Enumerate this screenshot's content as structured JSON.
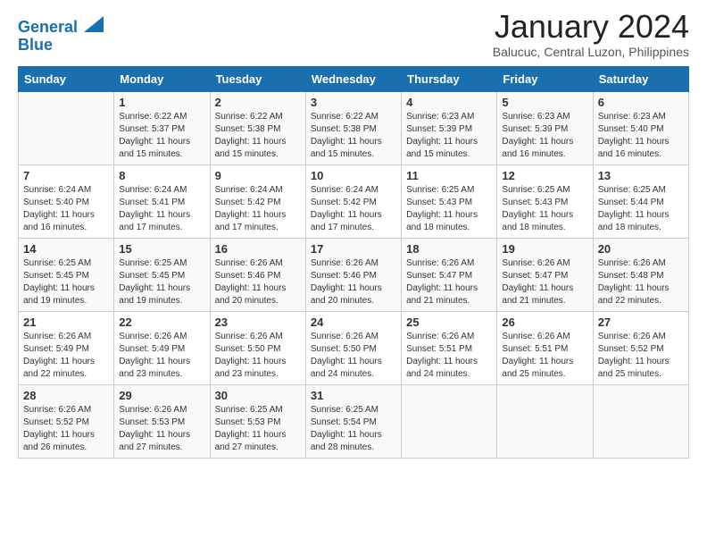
{
  "header": {
    "logo_line1": "General",
    "logo_line2": "Blue",
    "month_title": "January 2024",
    "subtitle": "Balucuc, Central Luzon, Philippines"
  },
  "weekdays": [
    "Sunday",
    "Monday",
    "Tuesday",
    "Wednesday",
    "Thursday",
    "Friday",
    "Saturday"
  ],
  "weeks": [
    [
      {
        "day": "",
        "sunrise": "",
        "sunset": "",
        "daylight": ""
      },
      {
        "day": "1",
        "sunrise": "Sunrise: 6:22 AM",
        "sunset": "Sunset: 5:37 PM",
        "daylight": "Daylight: 11 hours and 15 minutes."
      },
      {
        "day": "2",
        "sunrise": "Sunrise: 6:22 AM",
        "sunset": "Sunset: 5:38 PM",
        "daylight": "Daylight: 11 hours and 15 minutes."
      },
      {
        "day": "3",
        "sunrise": "Sunrise: 6:22 AM",
        "sunset": "Sunset: 5:38 PM",
        "daylight": "Daylight: 11 hours and 15 minutes."
      },
      {
        "day": "4",
        "sunrise": "Sunrise: 6:23 AM",
        "sunset": "Sunset: 5:39 PM",
        "daylight": "Daylight: 11 hours and 15 minutes."
      },
      {
        "day": "5",
        "sunrise": "Sunrise: 6:23 AM",
        "sunset": "Sunset: 5:39 PM",
        "daylight": "Daylight: 11 hours and 16 minutes."
      },
      {
        "day": "6",
        "sunrise": "Sunrise: 6:23 AM",
        "sunset": "Sunset: 5:40 PM",
        "daylight": "Daylight: 11 hours and 16 minutes."
      }
    ],
    [
      {
        "day": "7",
        "sunrise": "Sunrise: 6:24 AM",
        "sunset": "Sunset: 5:40 PM",
        "daylight": "Daylight: 11 hours and 16 minutes."
      },
      {
        "day": "8",
        "sunrise": "Sunrise: 6:24 AM",
        "sunset": "Sunset: 5:41 PM",
        "daylight": "Daylight: 11 hours and 17 minutes."
      },
      {
        "day": "9",
        "sunrise": "Sunrise: 6:24 AM",
        "sunset": "Sunset: 5:42 PM",
        "daylight": "Daylight: 11 hours and 17 minutes."
      },
      {
        "day": "10",
        "sunrise": "Sunrise: 6:24 AM",
        "sunset": "Sunset: 5:42 PM",
        "daylight": "Daylight: 11 hours and 17 minutes."
      },
      {
        "day": "11",
        "sunrise": "Sunrise: 6:25 AM",
        "sunset": "Sunset: 5:43 PM",
        "daylight": "Daylight: 11 hours and 18 minutes."
      },
      {
        "day": "12",
        "sunrise": "Sunrise: 6:25 AM",
        "sunset": "Sunset: 5:43 PM",
        "daylight": "Daylight: 11 hours and 18 minutes."
      },
      {
        "day": "13",
        "sunrise": "Sunrise: 6:25 AM",
        "sunset": "Sunset: 5:44 PM",
        "daylight": "Daylight: 11 hours and 18 minutes."
      }
    ],
    [
      {
        "day": "14",
        "sunrise": "Sunrise: 6:25 AM",
        "sunset": "Sunset: 5:45 PM",
        "daylight": "Daylight: 11 hours and 19 minutes."
      },
      {
        "day": "15",
        "sunrise": "Sunrise: 6:25 AM",
        "sunset": "Sunset: 5:45 PM",
        "daylight": "Daylight: 11 hours and 19 minutes."
      },
      {
        "day": "16",
        "sunrise": "Sunrise: 6:26 AM",
        "sunset": "Sunset: 5:46 PM",
        "daylight": "Daylight: 11 hours and 20 minutes."
      },
      {
        "day": "17",
        "sunrise": "Sunrise: 6:26 AM",
        "sunset": "Sunset: 5:46 PM",
        "daylight": "Daylight: 11 hours and 20 minutes."
      },
      {
        "day": "18",
        "sunrise": "Sunrise: 6:26 AM",
        "sunset": "Sunset: 5:47 PM",
        "daylight": "Daylight: 11 hours and 21 minutes."
      },
      {
        "day": "19",
        "sunrise": "Sunrise: 6:26 AM",
        "sunset": "Sunset: 5:47 PM",
        "daylight": "Daylight: 11 hours and 21 minutes."
      },
      {
        "day": "20",
        "sunrise": "Sunrise: 6:26 AM",
        "sunset": "Sunset: 5:48 PM",
        "daylight": "Daylight: 11 hours and 22 minutes."
      }
    ],
    [
      {
        "day": "21",
        "sunrise": "Sunrise: 6:26 AM",
        "sunset": "Sunset: 5:49 PM",
        "daylight": "Daylight: 11 hours and 22 minutes."
      },
      {
        "day": "22",
        "sunrise": "Sunrise: 6:26 AM",
        "sunset": "Sunset: 5:49 PM",
        "daylight": "Daylight: 11 hours and 23 minutes."
      },
      {
        "day": "23",
        "sunrise": "Sunrise: 6:26 AM",
        "sunset": "Sunset: 5:50 PM",
        "daylight": "Daylight: 11 hours and 23 minutes."
      },
      {
        "day": "24",
        "sunrise": "Sunrise: 6:26 AM",
        "sunset": "Sunset: 5:50 PM",
        "daylight": "Daylight: 11 hours and 24 minutes."
      },
      {
        "day": "25",
        "sunrise": "Sunrise: 6:26 AM",
        "sunset": "Sunset: 5:51 PM",
        "daylight": "Daylight: 11 hours and 24 minutes."
      },
      {
        "day": "26",
        "sunrise": "Sunrise: 6:26 AM",
        "sunset": "Sunset: 5:51 PM",
        "daylight": "Daylight: 11 hours and 25 minutes."
      },
      {
        "day": "27",
        "sunrise": "Sunrise: 6:26 AM",
        "sunset": "Sunset: 5:52 PM",
        "daylight": "Daylight: 11 hours and 25 minutes."
      }
    ],
    [
      {
        "day": "28",
        "sunrise": "Sunrise: 6:26 AM",
        "sunset": "Sunset: 5:52 PM",
        "daylight": "Daylight: 11 hours and 26 minutes."
      },
      {
        "day": "29",
        "sunrise": "Sunrise: 6:26 AM",
        "sunset": "Sunset: 5:53 PM",
        "daylight": "Daylight: 11 hours and 27 minutes."
      },
      {
        "day": "30",
        "sunrise": "Sunrise: 6:25 AM",
        "sunset": "Sunset: 5:53 PM",
        "daylight": "Daylight: 11 hours and 27 minutes."
      },
      {
        "day": "31",
        "sunrise": "Sunrise: 6:25 AM",
        "sunset": "Sunset: 5:54 PM",
        "daylight": "Daylight: 11 hours and 28 minutes."
      },
      {
        "day": "",
        "sunrise": "",
        "sunset": "",
        "daylight": ""
      },
      {
        "day": "",
        "sunrise": "",
        "sunset": "",
        "daylight": ""
      },
      {
        "day": "",
        "sunrise": "",
        "sunset": "",
        "daylight": ""
      }
    ]
  ]
}
